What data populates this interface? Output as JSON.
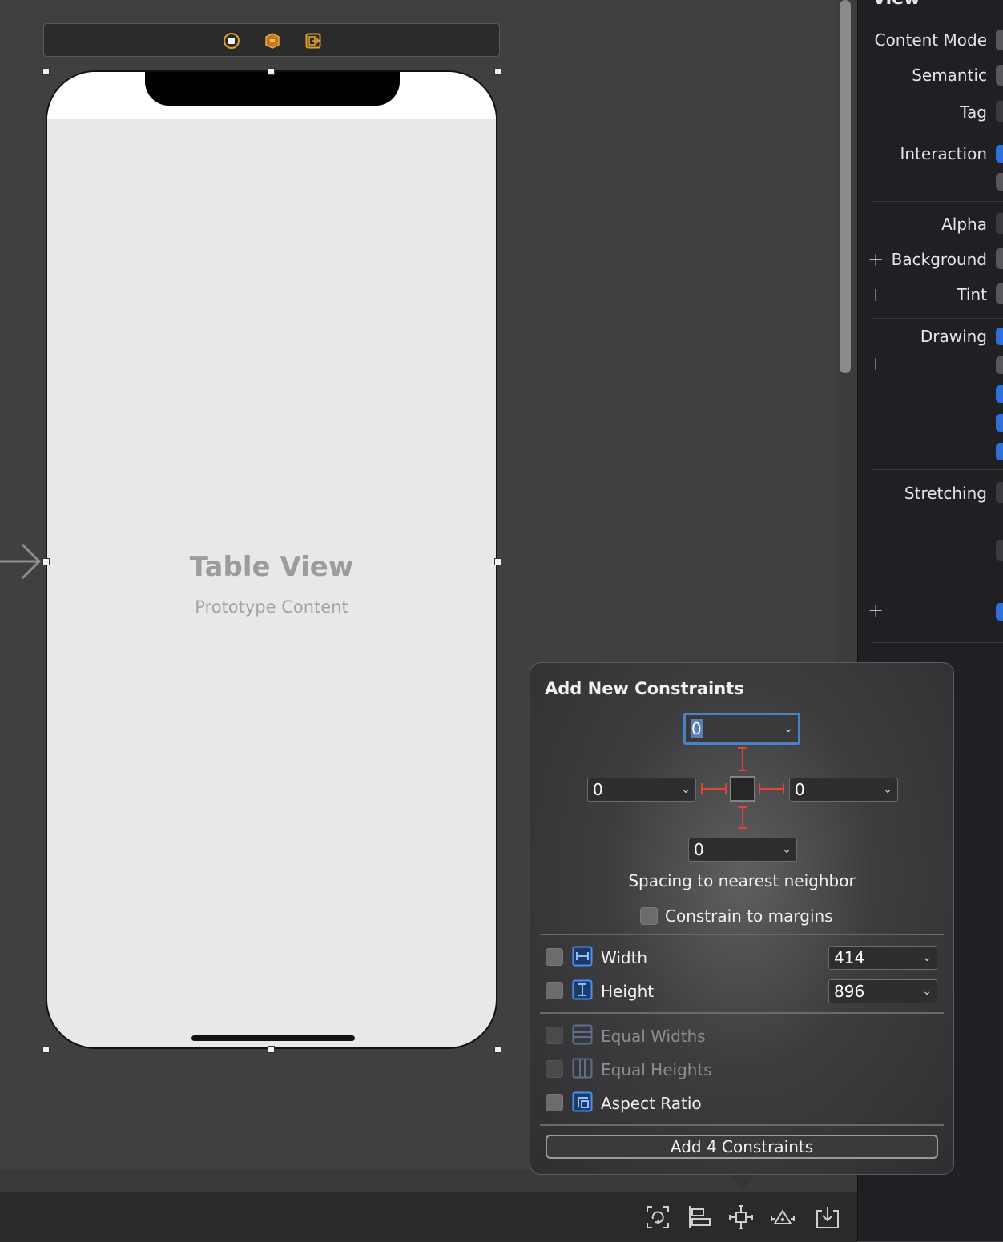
{
  "canvas": {
    "table_view": {
      "title": "Table View",
      "subtitle": "Prototype Content"
    }
  },
  "inspector": {
    "section": "View",
    "labels": {
      "content_mode": "Content Mode",
      "semantic": "Semantic",
      "tag": "Tag",
      "interaction": "Interaction",
      "alpha": "Alpha",
      "background": "Background",
      "tint": "Tint",
      "drawing": "Drawing",
      "stretching": "Stretching"
    },
    "plus_glyph": "+"
  },
  "popover": {
    "title": "Add New Constraints",
    "spacing": {
      "top": "0",
      "left": "0",
      "right": "0",
      "bottom": "0"
    },
    "chevron": "⌄",
    "spacing_caption": "Spacing to nearest neighbor",
    "constrain_margins": {
      "label": "Constrain to margins",
      "checked": false
    },
    "width": {
      "label": "Width",
      "value": "414",
      "checked": false
    },
    "height": {
      "label": "Height",
      "value": "896",
      "checked": false
    },
    "equal_widths": {
      "label": "Equal Widths",
      "enabled": false
    },
    "equal_heights": {
      "label": "Equal Heights",
      "enabled": false
    },
    "aspect_ratio": {
      "label": "Aspect Ratio",
      "checked": false
    },
    "add_button": "Add 4 Constraints"
  },
  "colors": {
    "accent_blue": "#2f6fdc",
    "constraint_red": "#e0443a",
    "dock_orange": "#e0a030"
  },
  "icons": {
    "dock": [
      "view-controller-icon",
      "first-responder-icon",
      "exit-icon"
    ],
    "bottombar": [
      "update-frames-icon",
      "align-icon",
      "add-constraints-icon",
      "resolve-issues-icon",
      "embed-in-icon"
    ]
  }
}
